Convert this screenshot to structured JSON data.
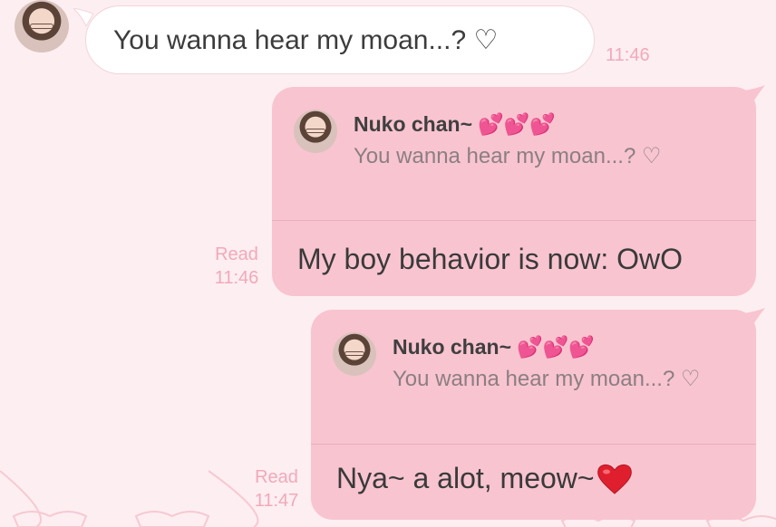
{
  "incoming": {
    "text": "You wanna hear my moan...? ♡",
    "time": "11:46"
  },
  "outgoing": [
    {
      "quote": {
        "name": "Nuko chan~",
        "emoji": "💕💕💕",
        "text": "You wanna hear my moan...? ♡"
      },
      "text": "My boy behavior is now: OwO",
      "read": "Read",
      "time": "11:46"
    },
    {
      "quote": {
        "name": "Nuko chan~",
        "emoji": "💕💕💕",
        "text": "You wanna hear my moan...? ♡"
      },
      "text": "Nya~ a alot, meow~",
      "read": "Read",
      "time": "11:47"
    }
  ],
  "colors": {
    "background": "#fdeef1",
    "outgoing_bubble": "#f8c4d0",
    "incoming_bubble": "#ffffff",
    "timestamp": "#f2a9ba"
  }
}
